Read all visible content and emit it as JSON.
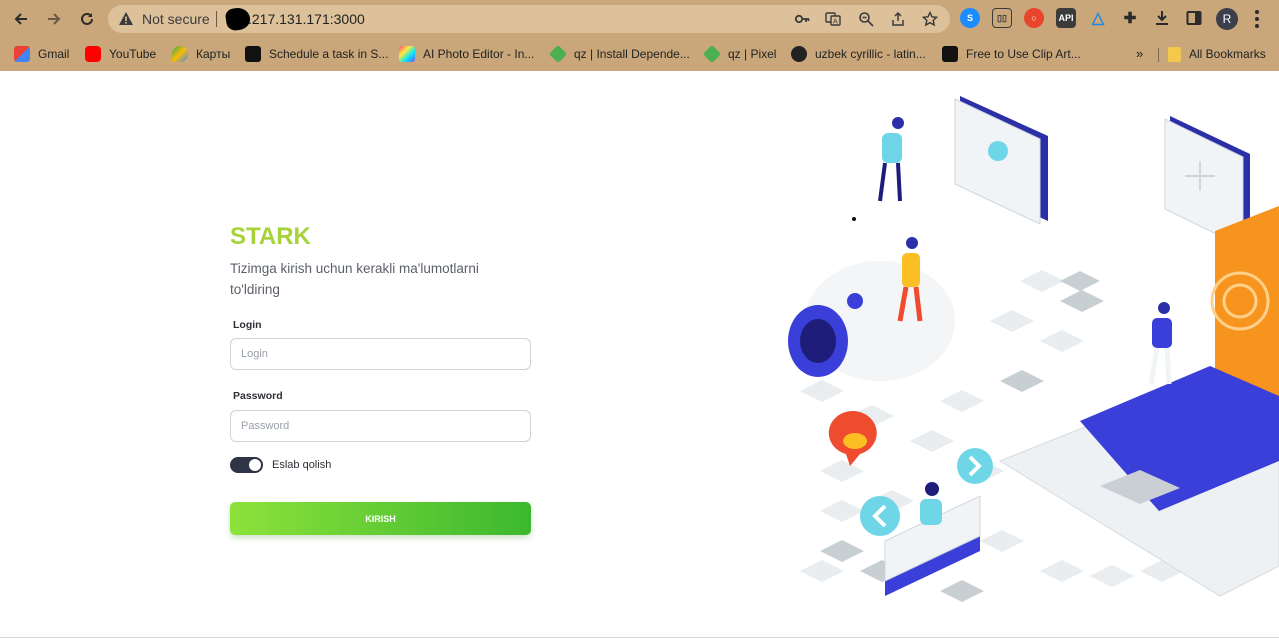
{
  "browser": {
    "security_label": "Not secure",
    "url": ".217.131.171:3000",
    "profile_initial": "R",
    "extensions": [
      {
        "icon": "shazam-icon",
        "color": "#1a8cff"
      },
      {
        "icon": "reader-icon",
        "color": "#5a4a36"
      },
      {
        "icon": "record-icon",
        "color": "#e8452c"
      },
      {
        "icon": "api-icon",
        "label": "API",
        "color": "#3b3b3b"
      },
      {
        "icon": "triangle-icon",
        "color": "#1e88e5"
      }
    ],
    "bookmarks": [
      {
        "label": "Gmail",
        "icon": "gmail-icon",
        "color": "#ea4335"
      },
      {
        "label": "YouTube",
        "icon": "youtube-icon",
        "color": "#ff0000"
      },
      {
        "label": "Карты",
        "icon": "maps-icon",
        "color": "#34a853"
      },
      {
        "label": "Schedule a task in S...",
        "icon": "medium-icon",
        "color": "#111111"
      },
      {
        "label": "AI Photo Editor - In...",
        "icon": "photo-editor-icon",
        "color": "#e040fb"
      },
      {
        "label": "qz | Install Depende...",
        "icon": "qz-icon",
        "color": "#4caf50"
      },
      {
        "label": "qz | Pixel",
        "icon": "qz-icon",
        "color": "#4caf50"
      },
      {
        "label": "uzbek cyrillic - latin...",
        "icon": "globe-icon",
        "color": "#222222"
      },
      {
        "label": "Free to Use Clip Art...",
        "icon": "clipart-icon",
        "color": "#111111"
      }
    ],
    "more_label": "»",
    "all_bookmarks": "All Bookmarks"
  },
  "login": {
    "brand": "STARK",
    "subtitle": "Tizimga kirish uchun kerakli ma'lumotlarni to'ldiring",
    "login_label": "Login",
    "login_placeholder": "Login",
    "password_label": "Password",
    "password_placeholder": "Password",
    "remember_label": "Eslab qolish",
    "remember_on": true,
    "submit_label": "KIRISH"
  },
  "colors": {
    "brand": "#a6d23a",
    "button_start": "#8de23a",
    "button_end": "#3cb82f",
    "accent_blue": "#3b3fd9",
    "accent_orange": "#f7941d"
  }
}
